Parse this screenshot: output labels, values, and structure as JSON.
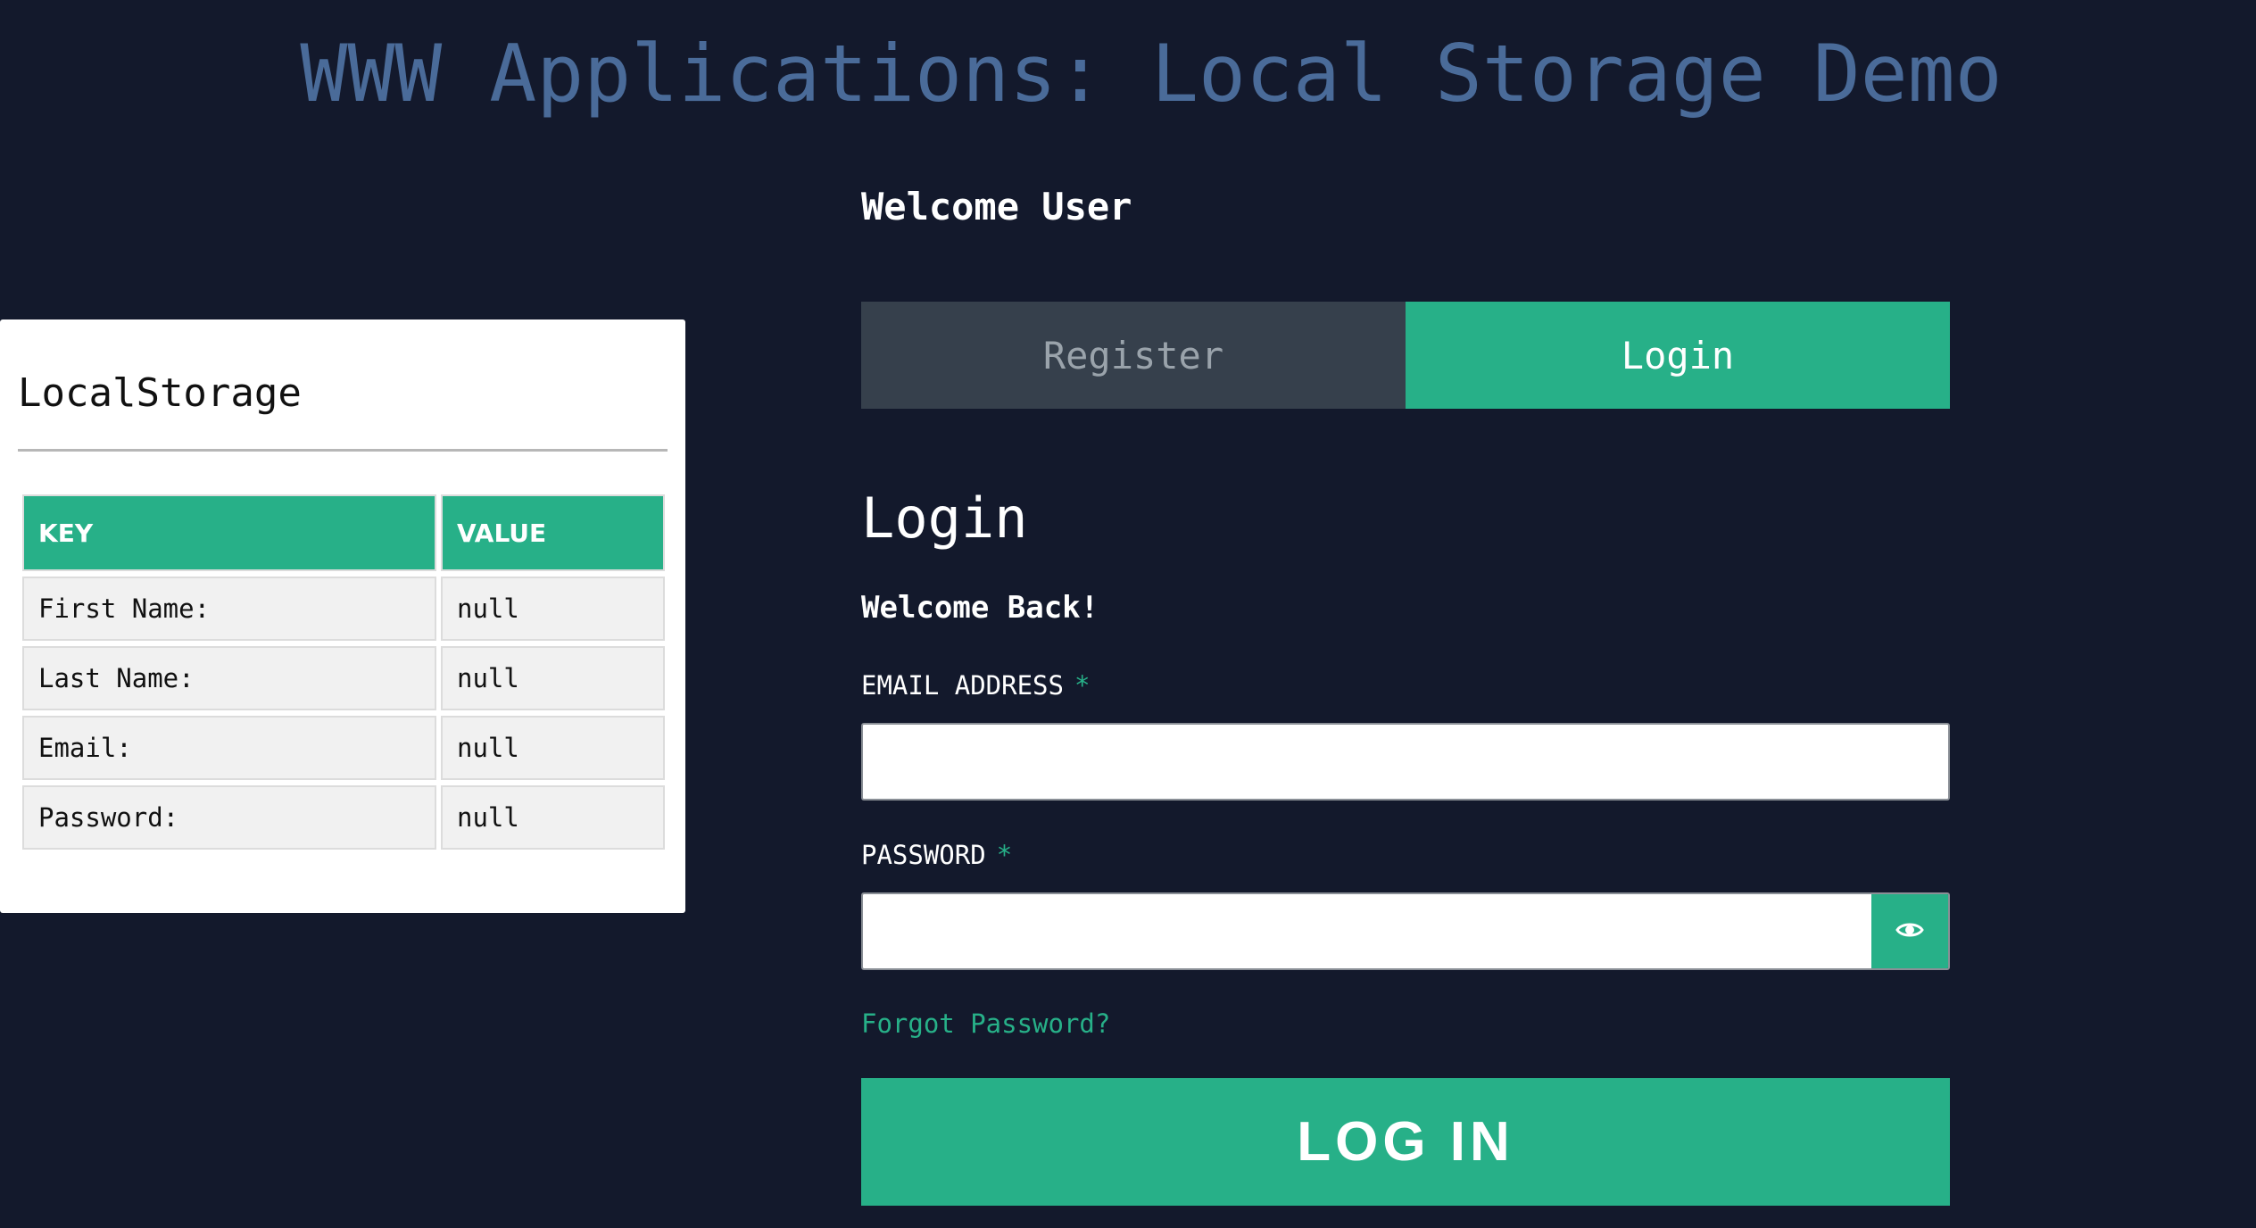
{
  "header": {
    "title": "WWW Applications: Local Storage Demo"
  },
  "storage": {
    "title": "LocalStorage",
    "columns": [
      "KEY",
      "VALUE"
    ],
    "rows": [
      {
        "key": "First Name:",
        "value": "null"
      },
      {
        "key": "Last Name:",
        "value": "null"
      },
      {
        "key": "Email:",
        "value": "null"
      },
      {
        "key": "Password:",
        "value": "null"
      }
    ]
  },
  "auth": {
    "welcome": "Welcome User",
    "tabs": {
      "register": "Register",
      "login": "Login",
      "active": "login"
    },
    "form": {
      "heading": "Login",
      "subheading": "Welcome Back!",
      "email_label": "EMAIL ADDRESS",
      "email_value": "",
      "password_label": "PASSWORD",
      "password_value": "",
      "required_marker": "*",
      "forgot_link": "Forgot Password?",
      "submit_label": "LOG IN"
    }
  },
  "icons": {
    "reveal_password": "eye-icon"
  },
  "colors": {
    "background": "#13192c",
    "title": "#4a6b99",
    "accent": "#27b088",
    "inactive_tab": "#36404c"
  }
}
